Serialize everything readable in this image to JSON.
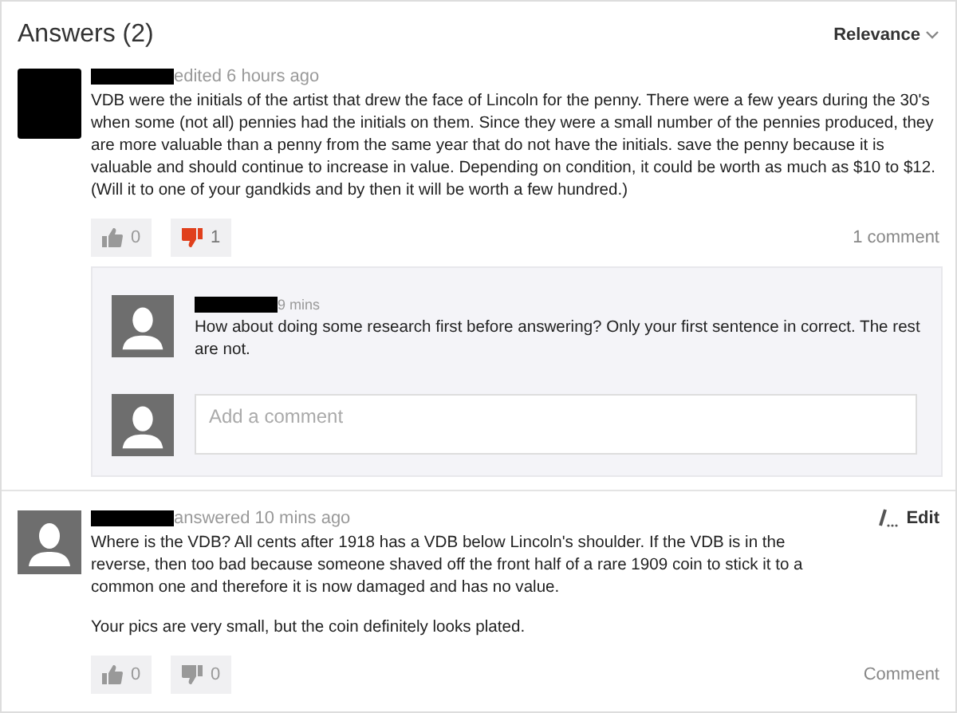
{
  "header": {
    "title": "Answers (2)",
    "sort": "Relevance"
  },
  "answers": [
    {
      "avatar_redacted": true,
      "meta": "edited 6 hours ago",
      "paragraphs": [
        "VDB were the initials of the artist that drew the face of Lincoln for the penny. There were a few years during the 30's when some (not all) pennies had the initials on them. Since they were a small number of the pennies produced, they are more valuable than a penny from the same year that do not have the initials. save the penny because it is valuable and should continue to increase in value. Depending on condition, it could be worth as much as $10 to $12. (Will it to one of your gandkids and by then it will be worth a few hundred.)"
      ],
      "upvote": {
        "count": "0",
        "selected": false
      },
      "downvote": {
        "count": "1",
        "selected": true
      },
      "comment_link": "1 comment",
      "comments": [
        {
          "time": "9 mins",
          "text": "How about doing some research first before answering? Only your first sentence in correct. The rest are not."
        }
      ],
      "comment_field": {
        "placeholder": "Add a comment"
      }
    },
    {
      "avatar_redacted": false,
      "meta": "answered 10 mins ago",
      "paragraphs": [
        "Where is the VDB? All cents after 1918 has a VDB below Lincoln's shoulder. If the VDB is in the reverse, then too bad because someone shaved off the front half of a rare 1909 coin to stick it to a common one and therefore it is now damaged and has no value.",
        "Your pics are very small, but the coin definitely looks plated."
      ],
      "edit": "Edit",
      "upvote": {
        "count": "0",
        "selected": false
      },
      "downvote": {
        "count": "0",
        "selected": false
      },
      "comment_link": "Comment"
    }
  ]
}
